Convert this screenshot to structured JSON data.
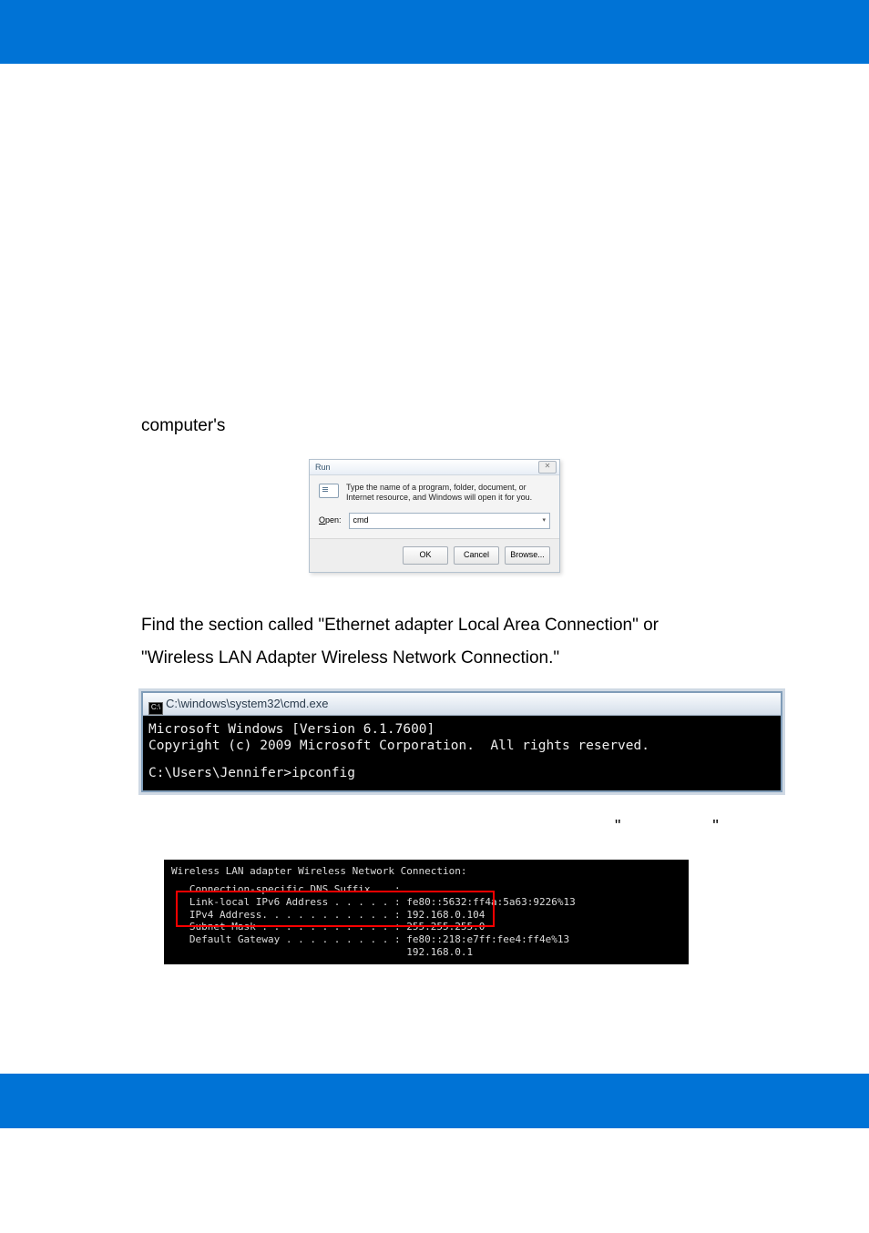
{
  "intro_word": "computer's",
  "run_dialog": {
    "title": "Run",
    "close_label": "✕",
    "description": "Type the name of a program, folder, document, or Internet resource, and Windows will open it for you.",
    "open_label_prefix": "O",
    "open_label_rest": "pen:",
    "value": "cmd",
    "buttons": {
      "ok": "OK",
      "cancel": "Cancel",
      "browse": "Browse..."
    }
  },
  "section_line1": "Find the section called \"Ethernet adapter Local Area Connection\" or",
  "section_line2": "\"Wireless LAN Adapter Wireless Network Connection.\"",
  "cmd_window": {
    "icon_text": "C:\\",
    "title": "C:\\windows\\system32\\cmd.exe",
    "line1": "Microsoft Windows [Version 6.1.7600]",
    "line2": "Copyright (c) 2009 Microsoft Corporation.  All rights reserved.",
    "line3": "C:\\Users\\Jennifer>ipconfig"
  },
  "stray_quotes": {
    "left": "\"",
    "right": "\""
  },
  "ipconfig": {
    "header": "Wireless LAN adapter Wireless Network Connection:",
    "l1": "   Connection-specific DNS Suffix  . :",
    "l2": "   Link-local IPv6 Address . . . . . : fe80::5632:ff4a:5a63:9226%13",
    "l3": "   IPv4 Address. . . . . . . . . . . : 192.168.0.104",
    "l4": "   Subnet Mask . . . . . . . . . . . : 255.255.255.0",
    "l5": "   Default Gateway . . . . . . . . . : fe80::218:e7ff:fee4:ff4e%13",
    "l6": "                                       192.168.0.1"
  }
}
